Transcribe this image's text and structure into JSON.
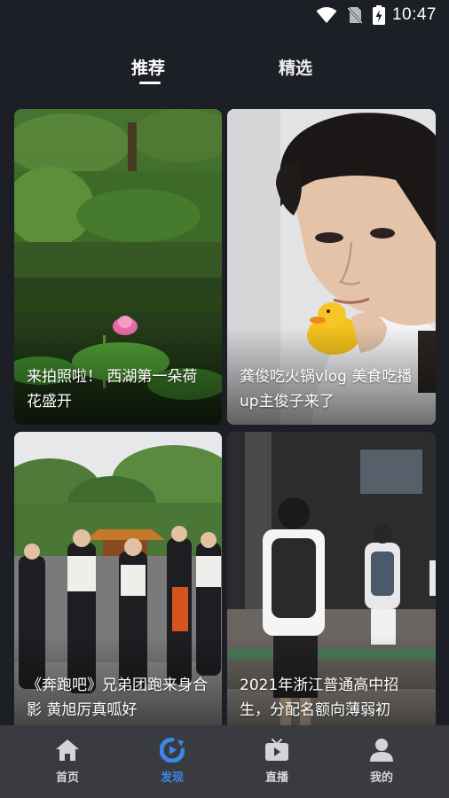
{
  "status_bar": {
    "time": "10:47",
    "icons": [
      "wifi-icon",
      "no-sim-icon",
      "battery-charging-icon"
    ]
  },
  "tabs": [
    {
      "label": "推荐",
      "active": true
    },
    {
      "label": "精选",
      "active": false
    }
  ],
  "cards": [
    {
      "title": "来拍照啦！ 西湖第一朵荷花盛开",
      "image": "lotus-pond-photo"
    },
    {
      "title": "龚俊吃火锅vlog 美食吃播up主俊子来了",
      "image": "man-with-rubber-duck-photo"
    },
    {
      "title": "《奔跑吧》兄弟团跑来身合影 黄旭厉真呱好",
      "image": "group-photo-pavilion"
    },
    {
      "title": "2021年浙江普通高中招生，分配名额向薄弱初",
      "image": "students-walking-photo"
    }
  ],
  "bottom_nav": [
    {
      "label": "首页",
      "icon": "home-icon",
      "active": false
    },
    {
      "label": "发现",
      "icon": "discover-icon",
      "active": true
    },
    {
      "label": "直播",
      "icon": "tv-icon",
      "active": false
    },
    {
      "label": "我的",
      "icon": "user-icon",
      "active": false
    }
  ],
  "colors": {
    "background": "#1d1f27",
    "nav_background": "#3a3b40",
    "accent": "#3b86e6"
  }
}
